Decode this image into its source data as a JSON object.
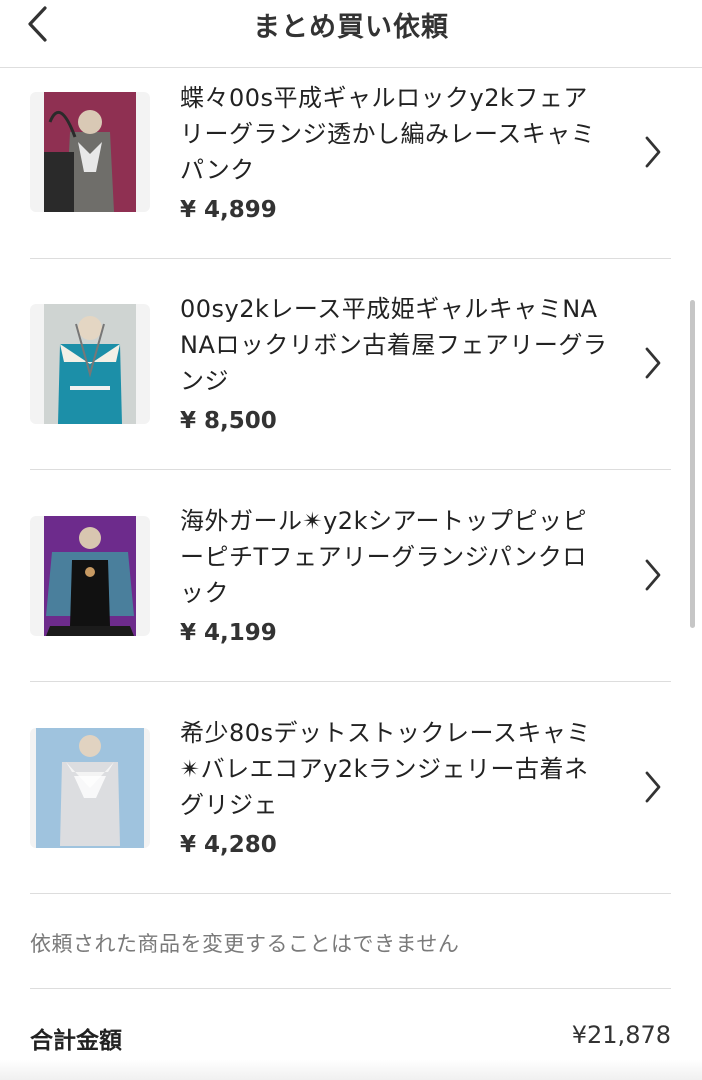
{
  "header": {
    "title": "まとめ買い依頼",
    "back_icon": "chevron-left-icon"
  },
  "items": [
    {
      "title": "蝶々00s平成ギャルロックy2kフェアリーグランジ透かし編みレースキャミパンク",
      "price": "¥ 4,899",
      "thumb_bg": "#8f3052"
    },
    {
      "title": "00sy2kレース平成姫ギャルキャミNANAロックリボン古着屋フェアリーグランジ",
      "price": "¥ 8,500",
      "thumb_bg": "#cfd4d2"
    },
    {
      "title": "海外ガール✴︎y2kシアートップピッピーピチTフェアリーグランジパンクロック",
      "price": "¥ 4,199",
      "thumb_bg": "#6d2b8c"
    },
    {
      "title": "希少80sデットストックレースキャミ✴︎バレエコアy2kランジェリー古着ネグリジェ",
      "price": "¥ 4,280",
      "thumb_bg": "#9fc3de"
    }
  ],
  "notice": "依頼された商品を変更することはできません",
  "total": {
    "label": "合計金額",
    "value": "¥21,878"
  },
  "colors": {
    "text": "#222222",
    "muted": "#7a7a7a",
    "divider": "#dddddd"
  }
}
